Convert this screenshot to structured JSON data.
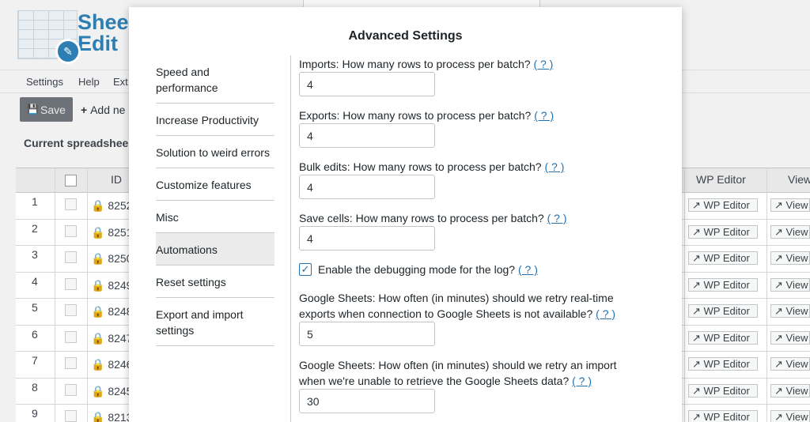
{
  "app": {
    "logo_text_line1": "Shee",
    "logo_text_line2": "Edit",
    "menu": [
      "Settings",
      "Help",
      "Ext"
    ],
    "save_label": "Save",
    "add_label": "Add ne",
    "current_sheet": "Current spreadshee"
  },
  "grid": {
    "headers": {
      "id": "ID",
      "wp_editor": "WP Editor",
      "view": "View"
    },
    "rows": [
      {
        "num": "1",
        "id": "8252",
        "wp": "WP Editor",
        "view": "View"
      },
      {
        "num": "2",
        "id": "8251",
        "wp": "WP Editor",
        "view": "View"
      },
      {
        "num": "3",
        "id": "8250",
        "wp": "WP Editor",
        "view": "View"
      },
      {
        "num": "4",
        "id": "8249",
        "wp": "WP Editor",
        "view": "View"
      },
      {
        "num": "5",
        "id": "8248",
        "wp": "WP Editor",
        "view": "View"
      },
      {
        "num": "6",
        "id": "8247",
        "wp": "WP Editor",
        "view": "View"
      },
      {
        "num": "7",
        "id": "8246",
        "wp": "WP Editor",
        "view": "View"
      },
      {
        "num": "8",
        "id": "8245",
        "wp": "WP Editor",
        "view": "View"
      },
      {
        "num": "9",
        "id": "8213",
        "wp": "WP Editor",
        "view": "View"
      }
    ]
  },
  "modal": {
    "title": "Advanced Settings",
    "sidebar": [
      {
        "label": "Speed and performance",
        "active": false
      },
      {
        "label": "Increase Productivity",
        "active": false
      },
      {
        "label": "Solution to weird errors",
        "active": false
      },
      {
        "label": "Customize features",
        "active": false
      },
      {
        "label": "Misc",
        "active": false
      },
      {
        "label": "Automations",
        "active": true
      },
      {
        "label": "Reset settings",
        "active": false
      },
      {
        "label": "Export and import settings",
        "active": false
      }
    ],
    "help_text": "( ? )",
    "fields": {
      "imports": {
        "label": "Imports: How many rows to process per batch?",
        "value": "4"
      },
      "exports": {
        "label": "Exports: How many rows to process per batch?",
        "value": "4"
      },
      "bulk": {
        "label": "Bulk edits: How many rows to process per batch?",
        "value": "4"
      },
      "save": {
        "label": "Save cells: How many rows to process per batch?",
        "value": "4"
      },
      "debug": {
        "label": "Enable the debugging mode for the log?",
        "checked": true
      },
      "gs_export": {
        "label": "Google Sheets: How often (in minutes) should we retry real-time exports when connection to Google Sheets is not available?",
        "value": "5"
      },
      "gs_import": {
        "label": "Google Sheets: How often (in minutes) should we retry an import when we're unable to retrieve the Google Sheets data?",
        "value": "30"
      }
    }
  },
  "colors": {
    "accent": "#2271b1",
    "brand": "#2d7fb3"
  }
}
